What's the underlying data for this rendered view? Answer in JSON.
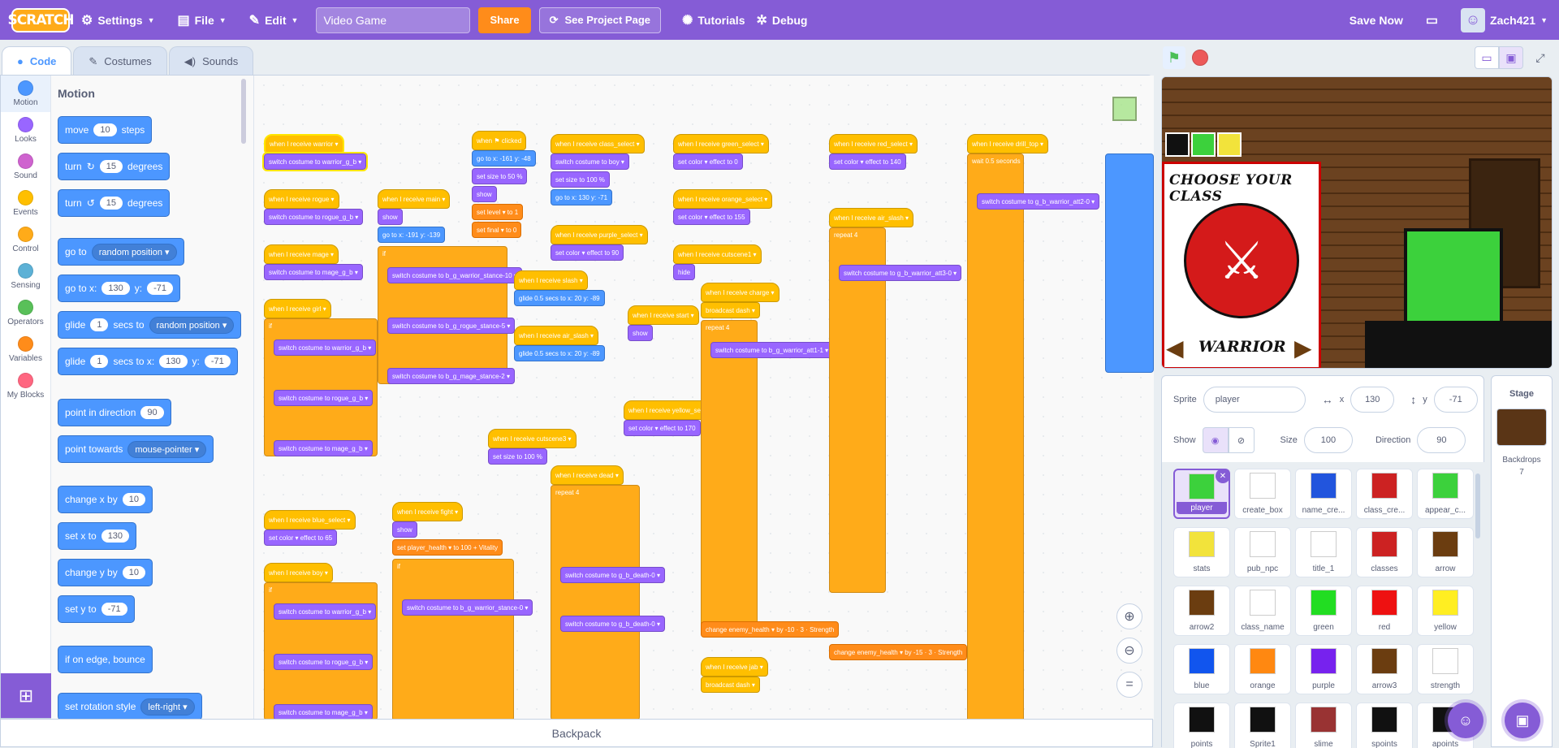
{
  "menubar": {
    "logo": "SCRATCH",
    "settings": "Settings",
    "file": "File",
    "edit": "Edit",
    "project_title": "Video Game",
    "share": "Share",
    "see_project": "See Project Page",
    "tutorials": "Tutorials",
    "debug": "Debug",
    "save_now": "Save Now",
    "username": "Zach421"
  },
  "tabs": [
    {
      "label": "Code"
    },
    {
      "label": "Costumes"
    },
    {
      "label": "Sounds"
    }
  ],
  "categories": [
    {
      "label": "Motion",
      "color": "#4c97ff"
    },
    {
      "label": "Looks",
      "color": "#9966ff"
    },
    {
      "label": "Sound",
      "color": "#cf63cf"
    },
    {
      "label": "Events",
      "color": "#ffbf00"
    },
    {
      "label": "Control",
      "color": "#ffab19"
    },
    {
      "label": "Sensing",
      "color": "#5cb1d6"
    },
    {
      "label": "Operators",
      "color": "#59c059"
    },
    {
      "label": "Variables",
      "color": "#ff8c1a"
    },
    {
      "label": "My Blocks",
      "color": "#ff6680"
    }
  ],
  "palette": {
    "heading": "Motion",
    "move": "move",
    "move_val": "10",
    "steps": "steps",
    "turn": "turn",
    "turn_val": "15",
    "degrees": "degrees",
    "goto": "go to",
    "random_position": "random position",
    "goto_xy": "go to x:",
    "x_val": "130",
    "y": "y:",
    "y_val": "-71",
    "glide": "glide",
    "glide_val": "1",
    "secs_to": "secs to",
    "secs_to_x": "secs to x:",
    "point_dir": "point in direction",
    "dir_val": "90",
    "point_towards": "point towards",
    "mouse_pointer": "mouse-pointer",
    "change_x": "change x by",
    "set_x": "set x to",
    "change_y": "change y by",
    "set_y": "set y to",
    "bounce": "if on edge, bounce",
    "rot_style": "set rotation style",
    "left_right": "left-right"
  },
  "scripts": {
    "when_receive_warrior": "when I receive  warrior ▾",
    "switch_warrior_g_b": "switch costume to  warrior_g_b ▾",
    "when_receive_rogue": "when I receive  rogue ▾",
    "switch_rogue_g_b": "switch costume to  rogue_g_b ▾",
    "when_receive_mage": "when I receive  mage ▾",
    "switch_mage_g_b": "switch costume to  mage_g_b ▾",
    "when_receive_girl": "when I receive  girl ▾",
    "when_receive_main": "when I receive  main ▾",
    "show": "show",
    "goto_main": "go to x: -191  y: -139",
    "when_flag_clicked": "when ⚑ clicked",
    "goto_flag": "go to x: -161  y: -48",
    "set_size_50": "set size to 50 %",
    "set_level": "set  level ▾ to 1",
    "set_final": "set  final ▾ to 0",
    "when_receive_class_select": "when I receive  class_select ▾",
    "switch_boy": "switch costume to  boy ▾",
    "set_size_100": "set size to 100 %",
    "goto_130": "go to x: 130  y: -71",
    "when_receive_green_select": "when I receive  green_select ▾",
    "set_color_0": "set  color ▾ effect to 0",
    "when_receive_red_select": "when I receive  red_select ▾",
    "set_color_140": "set  color ▾ effect to 140",
    "when_receive_drill_top": "when I receive  drill_top ▾",
    "wait_05": "wait 0.5 seconds",
    "repeat_4": "repeat 4",
    "att2_0": "switch costume to  g_b_warrior_att2-0 ▾",
    "when_receive_orange_select": "when I receive  orange_select ▾",
    "set_color_155": "set  color ▾ effect to 155",
    "when_receive_purple_select": "when I receive  purple_select ▾",
    "set_color_90": "set  color ▾ effect to 90",
    "when_receive_cutscene1": "when I receive  cutscene1 ▾",
    "hide": "hide",
    "when_receive_slash": "when I receive  slash ▾",
    "glide_05_20": "glide 0.5 secs to x: 20  y: -89",
    "when_receive_air_slash": "when I receive  air_slash ▾",
    "when_receive_start": "when I receive  start ▾",
    "when_receive_charge": "when I receive  charge ▾",
    "broadcast_dash": "broadcast  dash ▾",
    "when_receive_yellow_select": "when I receive  yellow_select ▾",
    "set_color_170": "set  color ▾ effect to 170",
    "when_receive_cutscene3": "when I receive  cutscene3 ▾",
    "when_receive_dead": "when I receive  dead ▾",
    "when_receive_blue_select": "when I receive  blue_select ▾",
    "set_color_65": "set  color ▾ effect to 65",
    "when_receive_boy": "when I receive  boy ▾",
    "when_receive_fight": "when I receive  fight ▾",
    "set_player_health": "set  player_health ▾ to 100 + Vitality",
    "change_enemy_health": "change  enemy_health ▾ by -10 · 3 · Strength",
    "change_enemy_health2": "change  enemy_health ▾ by -15 · 3 · Strength",
    "when_receive_jab": "when I receive  jab ▾",
    "stance_10": "switch costume to  b_g_warrior_stance-10 ▾",
    "rogue_stance_5": "switch costume to  b_g_rogue_stance-5 ▾",
    "mage_stance_2": "switch costume to  b_g_mage_stance-2 ▾",
    "warrior_att1_1": "switch costume to  b_g_warrior_att1-1 ▾",
    "warrior_att3_0": "switch costume to  g_b_warrior_att3-0 ▾",
    "death_0": "switch costume to  g_b_death-0 ▾",
    "stance_0": "switch costume to  b_g_warrior_stance-0 ▾"
  },
  "stage": {
    "heading": "Choose Your Class",
    "class_name": "Warrior"
  },
  "sprite_info": {
    "sprite_label": "Sprite",
    "sprite_name": "player",
    "x_label": "x",
    "x": "130",
    "y_label": "y",
    "y": "-71",
    "show_label": "Show",
    "size_label": "Size",
    "size": "100",
    "direction_label": "Direction",
    "direction": "90"
  },
  "sprites": [
    {
      "name": "player",
      "color": "#3cd13c"
    },
    {
      "name": "create_box",
      "color": "#ffffff"
    },
    {
      "name": "name_cre...",
      "color": "#2255dd"
    },
    {
      "name": "class_cre...",
      "color": "#cc2222"
    },
    {
      "name": "appear_c...",
      "color": "#3cd13c"
    },
    {
      "name": "stats",
      "color": "#f2e33b"
    },
    {
      "name": "pub_npc",
      "color": "#ffffff"
    },
    {
      "name": "title_1",
      "color": "#ffffff"
    },
    {
      "name": "classes",
      "color": "#cc2222"
    },
    {
      "name": "arrow",
      "color": "#6b3d10"
    },
    {
      "name": "arrow2",
      "color": "#6b3d10"
    },
    {
      "name": "class_name",
      "color": "#ffffff"
    },
    {
      "name": "green",
      "color": "#22dd22"
    },
    {
      "name": "red",
      "color": "#ee1111"
    },
    {
      "name": "yellow",
      "color": "#ffee22"
    },
    {
      "name": "blue",
      "color": "#1155ee"
    },
    {
      "name": "orange",
      "color": "#ff8811"
    },
    {
      "name": "purple",
      "color": "#7722ee"
    },
    {
      "name": "arrow3",
      "color": "#6b3d10"
    },
    {
      "name": "strength",
      "color": "#ffffff"
    },
    {
      "name": "points",
      "color": "#111111"
    },
    {
      "name": "Sprite1",
      "color": "#111111"
    },
    {
      "name": "slime",
      "color": "#993333"
    },
    {
      "name": "spoints",
      "color": "#111111"
    },
    {
      "name": "apoints",
      "color": "#111111"
    }
  ],
  "backdrops": {
    "label": "Stage",
    "backdrops_label": "Backdrops",
    "count": "7"
  },
  "backpack": "Backpack"
}
